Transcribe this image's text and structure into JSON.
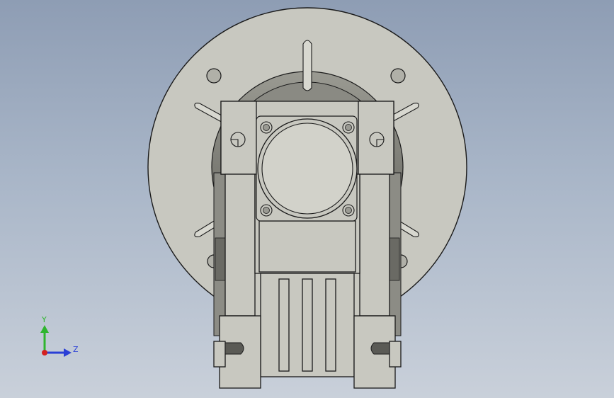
{
  "viewport": {
    "background_top": "#8e9db4",
    "background_bottom": "#c9d0da"
  },
  "model": {
    "body_color": "#c8c8c0",
    "edge_color": "#1a1a1a",
    "shadow_color": "#6e6e68"
  },
  "triad": {
    "y_label": "Y",
    "z_label": "Z",
    "y_color": "#2fb52f",
    "z_color": "#2a3fd6",
    "x_color": "#d42020"
  }
}
